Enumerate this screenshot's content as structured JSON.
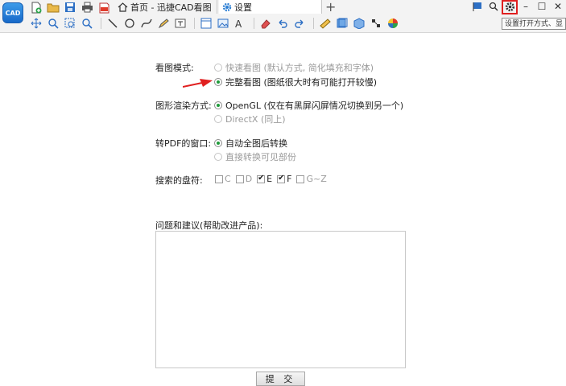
{
  "app": {
    "logo_text": "CAD"
  },
  "tabs": [
    {
      "label": "首页 - 迅捷CAD看图"
    },
    {
      "label": "设置"
    }
  ],
  "tooltip": "设置打开方式、显",
  "settings": {
    "view_mode": {
      "label": "看图模式:",
      "options": [
        {
          "label": "快速看图 (默认方式, 简化填充和字体)",
          "selected": false,
          "enabled": false
        },
        {
          "label": "完整看图 (图纸很大时有可能打开较慢)",
          "selected": true,
          "enabled": true
        }
      ]
    },
    "render_mode": {
      "label": "图形渲染方式:",
      "options": [
        {
          "label": "OpenGL (仅在有黑屏闪屏情况切换到另一个)",
          "selected": true,
          "enabled": true
        },
        {
          "label": "DirectX (同上)",
          "selected": false,
          "enabled": false
        }
      ]
    },
    "pdf_window": {
      "label": "转PDF的窗口:",
      "options": [
        {
          "label": "自动全图后转换",
          "selected": true,
          "enabled": true
        },
        {
          "label": "直接转换可见部份",
          "selected": false,
          "enabled": false
        }
      ]
    },
    "drives": {
      "label": "搜索的盘符:",
      "items": [
        {
          "label": "C",
          "checked": false
        },
        {
          "label": "D",
          "checked": false
        },
        {
          "label": "E",
          "checked": true
        },
        {
          "label": "F",
          "checked": true
        },
        {
          "label": "G~Z",
          "checked": false
        }
      ]
    },
    "feedback": {
      "label": "问题和建议(帮助改进产品):",
      "value": ""
    },
    "submit_label": "提 交"
  },
  "colors": {
    "radio_on": "#1f9b3a",
    "arrow": "#e02020",
    "highlight": "#e02020"
  }
}
